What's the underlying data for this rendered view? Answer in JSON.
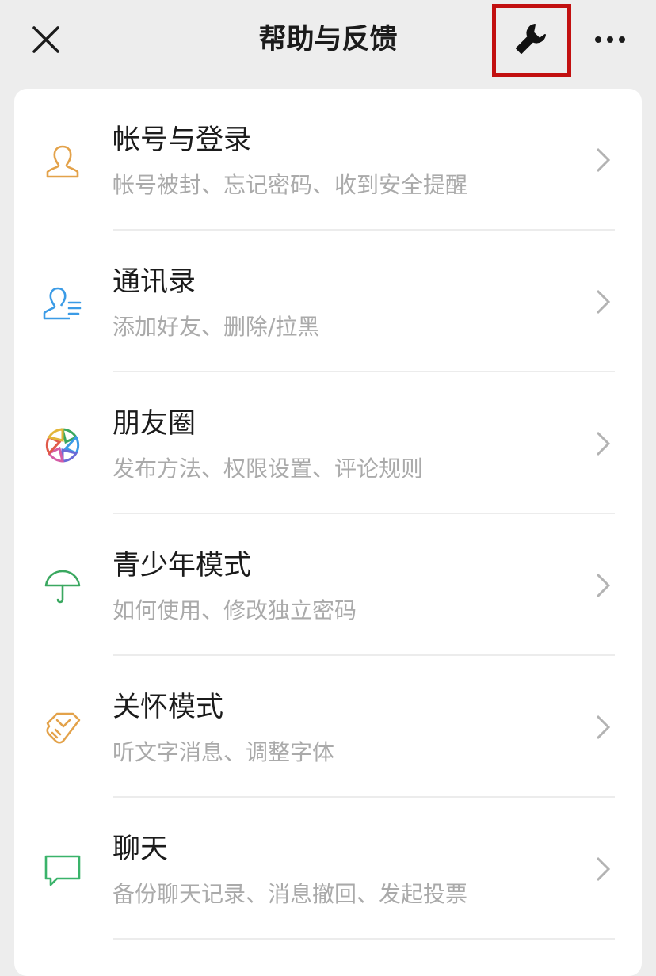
{
  "header": {
    "title": "帮助与反馈",
    "close_icon": "close-icon",
    "wrench_icon": "wrench-icon",
    "more_icon": "more-icon",
    "highlight_color": "#c21010"
  },
  "items": [
    {
      "title": "帐号与登录",
      "subtitle": "帐号被封、忘记密码、收到安全提醒",
      "icon": "person-icon",
      "color": "#e3a24a"
    },
    {
      "title": "通讯录",
      "subtitle": "添加好友、删除/拉黑",
      "icon": "contacts-icon",
      "color": "#3b9be6"
    },
    {
      "title": "朋友圈",
      "subtitle": "发布方法、权限设置、评论规则",
      "icon": "moments-icon",
      "color": "multicolor"
    },
    {
      "title": "青少年模式",
      "subtitle": "如何使用、修改独立密码",
      "icon": "umbrella-icon",
      "color": "#3aa860"
    },
    {
      "title": "关怀模式",
      "subtitle": "听文字消息、调整字体",
      "icon": "care-hand-icon",
      "color": "#e3a24a"
    },
    {
      "title": "聊天",
      "subtitle": "备份聊天记录、消息撤回、发起投票",
      "icon": "chat-bubble-icon",
      "color": "#3ab36a"
    }
  ]
}
